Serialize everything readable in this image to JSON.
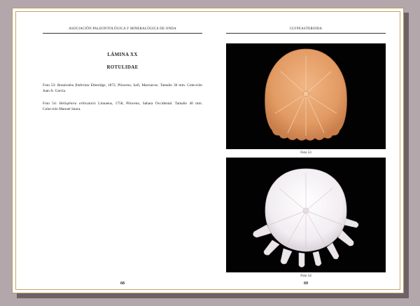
{
  "left_page": {
    "running_head": "Asociación Paleontológica y Mineralógica de Onda",
    "plate_title": "LÁMINA XX",
    "family_title": "ROTULIDAE",
    "captions": [
      {
        "prefix": "Foto 53:",
        "species": "Rotuloidea fimbriata",
        "text": "Etheridge, 1872, Plioceno, Safi, Marruecos. Tamaño 30 mm. Colección Juan A. García."
      },
      {
        "prefix": "Foto 54:",
        "species": "Heliophora orbicularis",
        "text": "Linnaeus, 1758, Plioceno, Sahara Occidental. Tamaño 40 mm. Colección Manuel Saura."
      }
    ],
    "page_number": "68"
  },
  "right_page": {
    "running_head": "CLYPEASTEROIDA",
    "photos": [
      {
        "label": "Foto 53"
      },
      {
        "label": "Foto 54"
      }
    ],
    "page_number": "69"
  },
  "colors": {
    "background": "#b3a7ab",
    "page_border": "#c9a46a",
    "photo_background": "#020202",
    "shell_53": "#e7a46e",
    "shell_54": "#f4f1f4"
  }
}
